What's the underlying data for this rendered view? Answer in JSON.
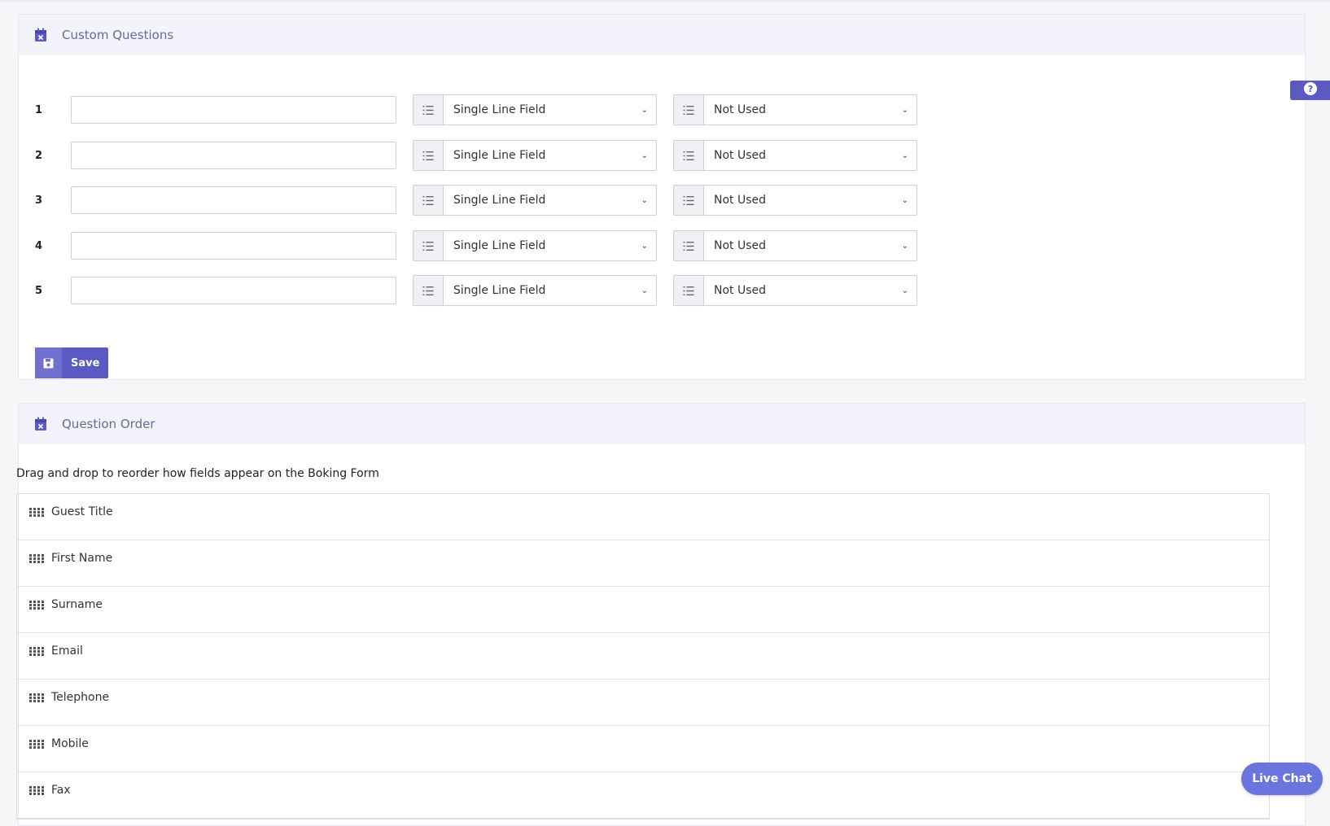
{
  "custom_questions": {
    "title": "Custom Questions",
    "icon": "calendar-x-icon",
    "rows": [
      {
        "number": "1",
        "input_value": "",
        "field_type": "Single Line Field",
        "usage": "Not Used"
      },
      {
        "number": "2",
        "input_value": "",
        "field_type": "Single Line Field",
        "usage": "Not Used"
      },
      {
        "number": "3",
        "input_value": "",
        "field_type": "Single Line Field",
        "usage": "Not Used"
      },
      {
        "number": "4",
        "input_value": "",
        "field_type": "Single Line Field",
        "usage": "Not Used"
      },
      {
        "number": "5",
        "input_value": "",
        "field_type": "Single Line Field",
        "usage": "Not Used"
      }
    ],
    "save_label": "Save"
  },
  "question_order": {
    "title": "Question Order",
    "icon": "calendar-x-icon",
    "description": "Drag and drop to reorder how fields appear on the Boking Form",
    "items": [
      "Guest Title",
      "First Name",
      "Surname",
      "Email",
      "Telephone",
      "Mobile",
      "Fax"
    ]
  },
  "help": {
    "icon": "question-circle-icon"
  },
  "live_chat": {
    "label": "Live Chat"
  },
  "colors": {
    "accent": "#5a5ac2",
    "header_bg": "#f3f3fc",
    "header_text": "#6a6a96",
    "live_chat": "#6a76dd"
  }
}
